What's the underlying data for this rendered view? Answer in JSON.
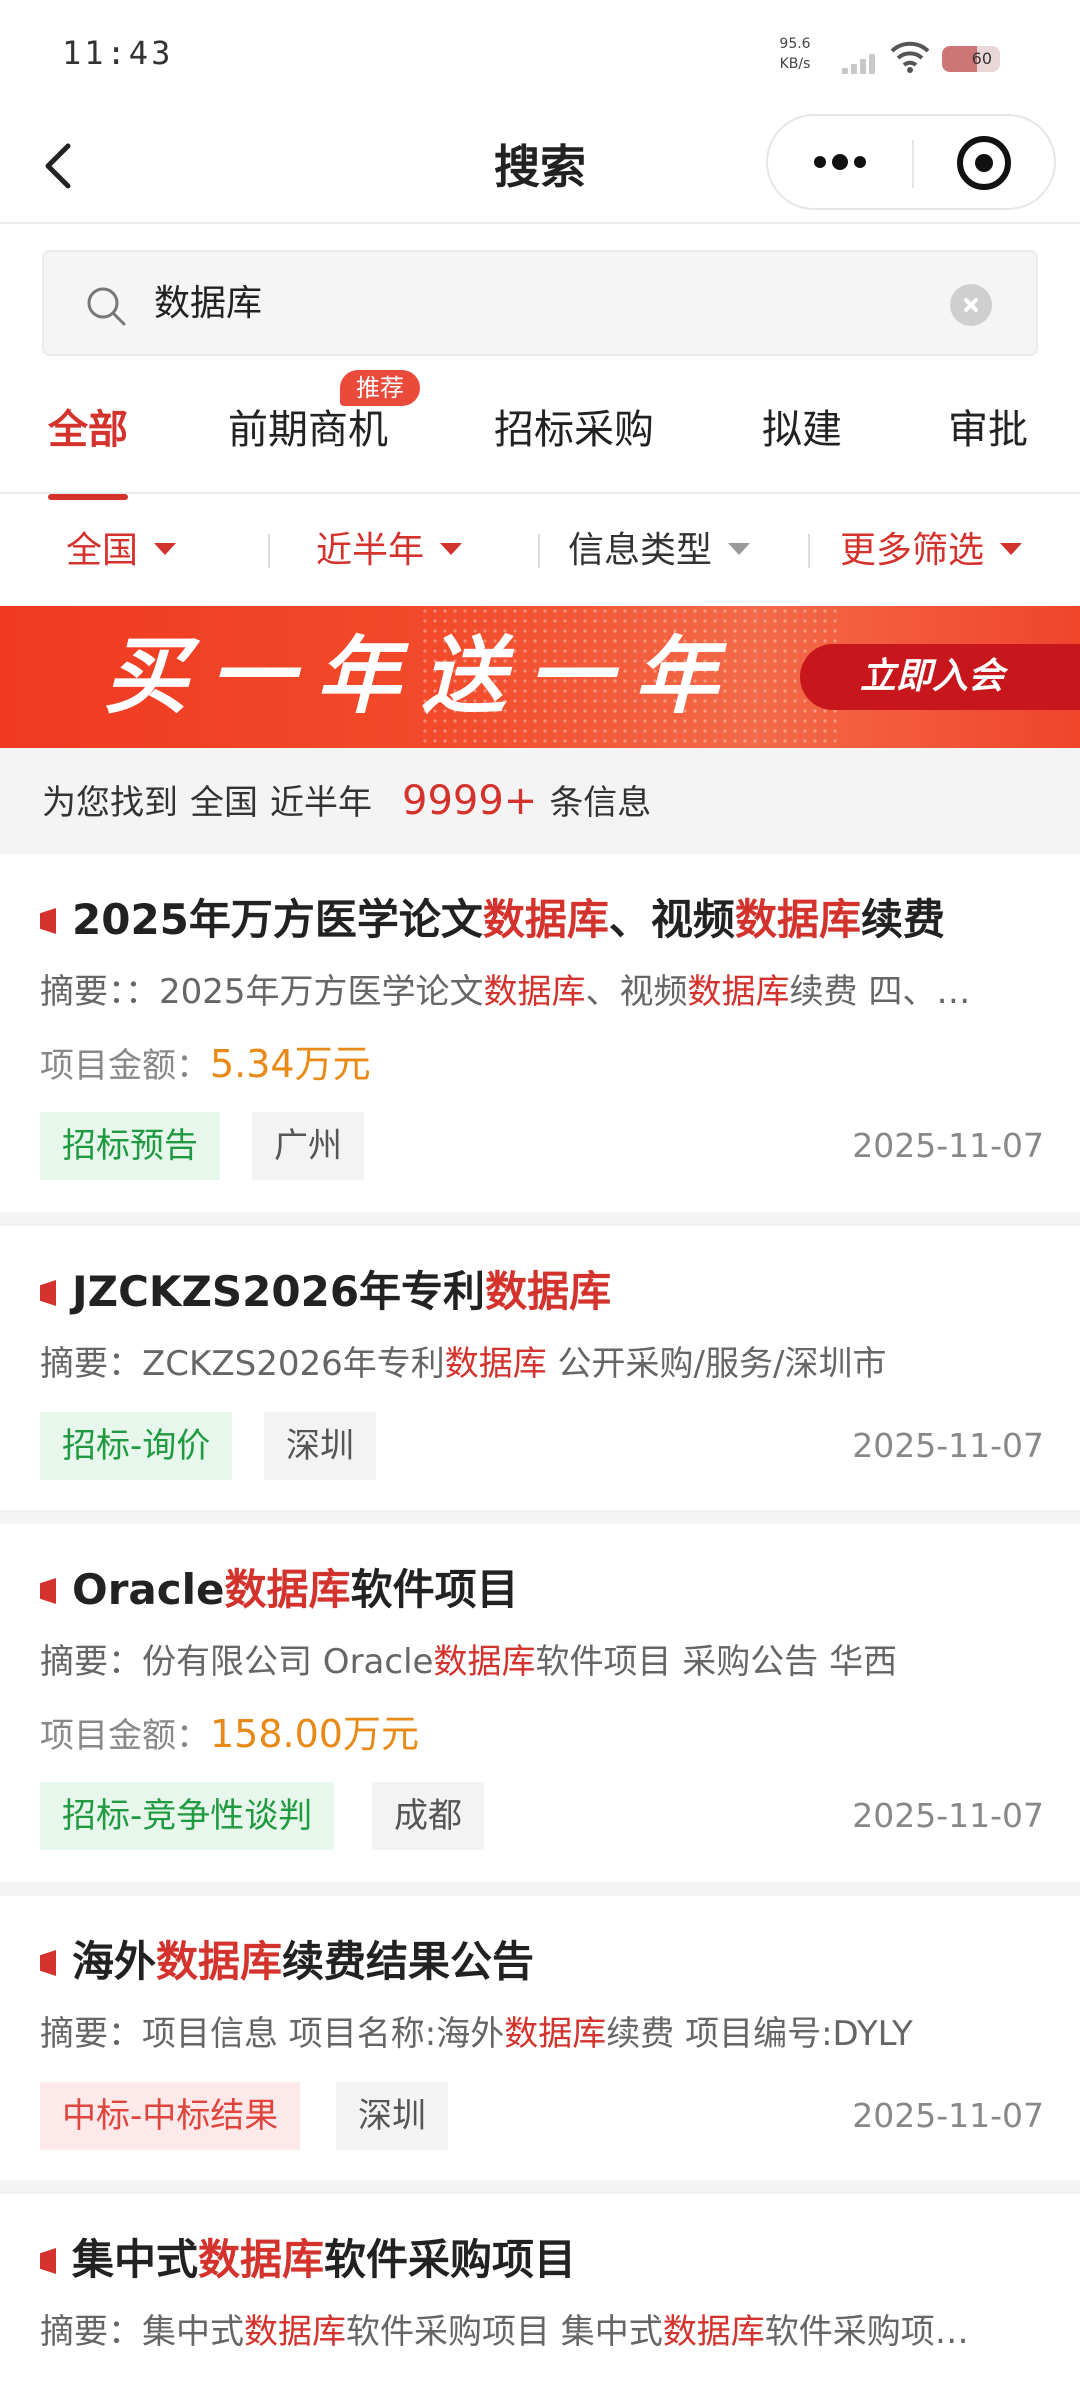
{
  "status_bar": {
    "time": "11:43",
    "net_speed_value": "95.6",
    "net_speed_unit": "KB/s",
    "battery": "60"
  },
  "nav": {
    "title": "搜索"
  },
  "search": {
    "query": "数据库"
  },
  "tabs": [
    {
      "label": "全部",
      "active": true
    },
    {
      "label": "前期商机",
      "badge": "推荐"
    },
    {
      "label": "招标采购"
    },
    {
      "label": "拟建"
    },
    {
      "label": "审批"
    }
  ],
  "filters": [
    {
      "label": "全国"
    },
    {
      "label": "近半年"
    },
    {
      "label": "信息类型"
    },
    {
      "label": "更多筛选"
    }
  ],
  "banner": {
    "title": "买一年送一年",
    "button": "立即入会"
  },
  "summary": {
    "prefix": "为您找到",
    "region": "全国",
    "period": "近半年",
    "count": "9999+",
    "suffix": "条信息"
  },
  "colors": {
    "accent": "#d4322c",
    "amount": "#e88a18",
    "tag_green": "#1f9a41",
    "tag_red": "#e0453d"
  },
  "results": [
    {
      "title": {
        "pre": "2025年万方医学论文",
        "hl1": "数据库",
        "mid": "、视频",
        "hl2": "数据库",
        "post": "续费"
      },
      "abstract": {
        "label": "摘要：",
        "pre": "：2025年万方医学论文",
        "hl1": "数据库",
        "mid": "、视频",
        "hl2": "数据库",
        "post": "续费 四、…"
      },
      "amount_label": "项目金额：",
      "amount": "5.34万元",
      "type_tag": "招标预告",
      "city_tag": "广州",
      "date": "2025-11-07"
    },
    {
      "title": {
        "pre": "JZCKZS2026年专利",
        "hl1": "数据库",
        "mid": "",
        "hl2": "",
        "post": ""
      },
      "abstract": {
        "label": "摘要：",
        "pre": "ZCKZS2026年专利",
        "hl1": "数据库",
        "mid": " 公开采购/服务/深圳市",
        "hl2": "",
        "post": ""
      },
      "type_tag": "招标-询价",
      "city_tag": "深圳",
      "date": "2025-11-07"
    },
    {
      "title": {
        "pre": "Oracle",
        "hl1": "数据库",
        "mid": "软件项目",
        "hl2": "",
        "post": ""
      },
      "abstract": {
        "label": "摘要：",
        "pre": "份有限公司 Oracle",
        "hl1": "数据库",
        "mid": "软件项目 采购公告 华西",
        "hl2": "",
        "post": ""
      },
      "amount_label": "项目金额：",
      "amount": "158.00万元",
      "type_tag": "招标-竞争性谈判",
      "city_tag": "成都",
      "date": "2025-11-07"
    },
    {
      "title": {
        "pre": "海外",
        "hl1": "数据库",
        "mid": "续费结果公告",
        "hl2": "",
        "post": ""
      },
      "abstract": {
        "label": "摘要：",
        "pre": "项目信息 项目名称:海外",
        "hl1": "数据库",
        "mid": "续费 项目编号:DYLY",
        "hl2": "",
        "post": ""
      },
      "type_tag": "中标-中标结果",
      "city_tag": "深圳",
      "date": "2025-11-07"
    },
    {
      "title": {
        "pre": "集中式",
        "hl1": "数据库",
        "mid": "软件采购项目",
        "hl2": "",
        "post": ""
      },
      "abstract": {
        "label": "摘要：",
        "pre": "集中式",
        "hl1": "数据库",
        "mid": "软件采购项目 集中式",
        "hl2": "数据库",
        "post": "软件采购项…"
      }
    }
  ]
}
